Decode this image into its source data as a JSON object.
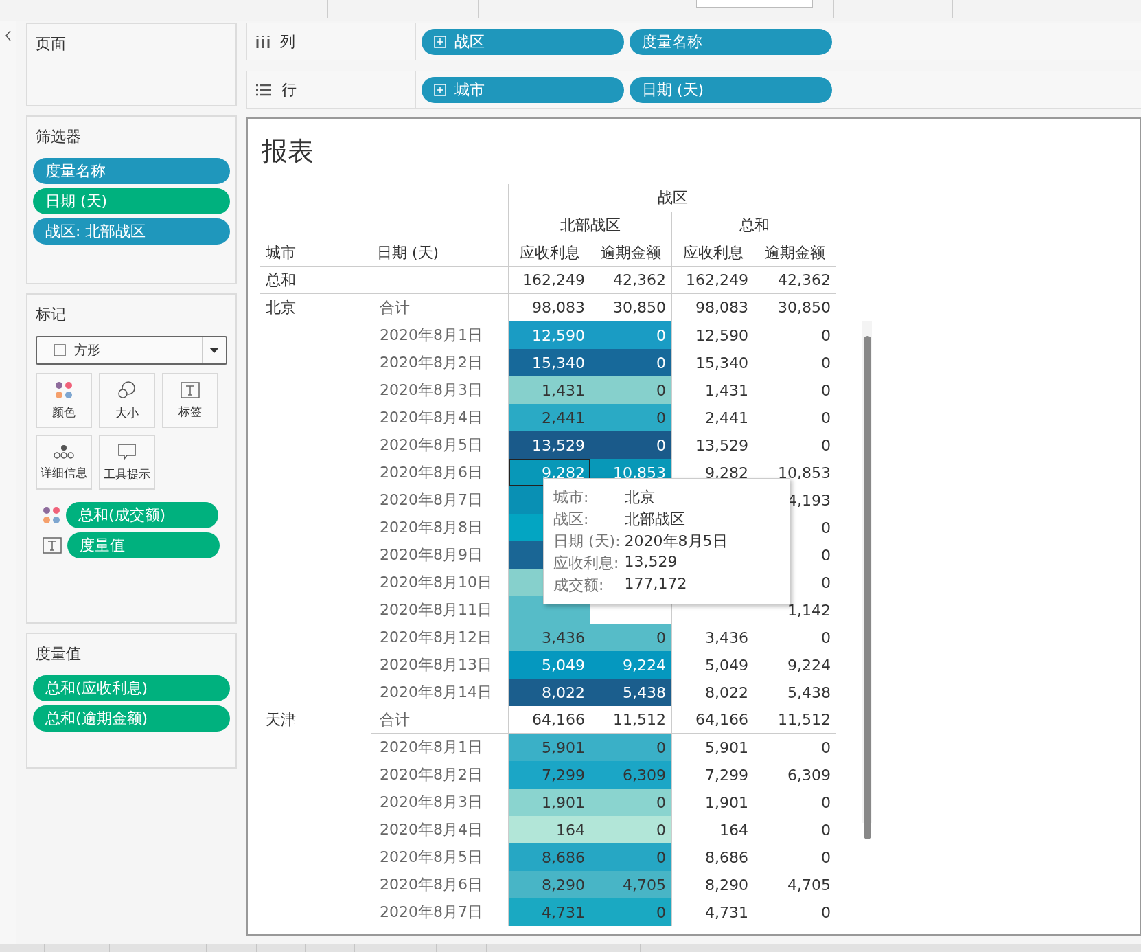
{
  "left_panel": {
    "pages": {
      "title": "页面"
    },
    "filters": {
      "title": "筛选器",
      "pills": [
        {
          "label": "度量名称",
          "kind": "dimension"
        },
        {
          "label": "日期 (天)",
          "kind": "measure"
        },
        {
          "label": "战区: 北部战区",
          "kind": "dimension"
        }
      ]
    },
    "marks": {
      "title": "标记",
      "mark_type": "方形",
      "buttons": [
        {
          "label": "颜色",
          "kind": "color"
        },
        {
          "label": "大小",
          "kind": "size"
        },
        {
          "label": "标签",
          "kind": "label"
        },
        {
          "label": "详细信息",
          "kind": "detail"
        },
        {
          "label": "工具提示",
          "kind": "tooltip"
        }
      ],
      "fields": [
        {
          "label": "总和(成交额)",
          "kind": "color"
        },
        {
          "label": "度量值",
          "kind": "label"
        }
      ]
    },
    "measure_values": {
      "title": "度量值",
      "pills": [
        {
          "label": "总和(应收利息)",
          "kind": "measure"
        },
        {
          "label": "总和(逾期金额)",
          "kind": "measure"
        }
      ]
    }
  },
  "shelves": [
    {
      "label": "列",
      "kind": "columns",
      "pills": [
        {
          "label": "战区",
          "kind": "dimension",
          "expandable": true
        },
        {
          "label": "度量名称",
          "kind": "dimension",
          "expandable": false
        }
      ]
    },
    {
      "label": "行",
      "kind": "rows",
      "pills": [
        {
          "label": "城市",
          "kind": "dimension",
          "expandable": true
        },
        {
          "label": "日期 (天)",
          "kind": "dimension",
          "expandable": false
        }
      ]
    }
  ],
  "view": {
    "title": "报表",
    "header": {
      "top": "战区",
      "groups": [
        "北部战区",
        "总和"
      ],
      "row_headers": [
        "城市",
        "日期 (天)"
      ],
      "columns": [
        "应收利息",
        "逾期金额",
        "应收利息",
        "逾期金额"
      ]
    },
    "rows": [
      {
        "kind": "grand_total",
        "label": "总和",
        "values": [
          "162,249",
          "42,362",
          "162,249",
          "42,362"
        ]
      },
      {
        "kind": "city_total",
        "city": "北京",
        "label": "合计",
        "values": [
          "98,083",
          "30,850",
          "98,083",
          "30,850"
        ]
      },
      {
        "kind": "day",
        "date": "2020年8月1日",
        "color": "#1a9cc4",
        "selected": false,
        "values": [
          "12,590",
          "0",
          "12,590",
          "0"
        ]
      },
      {
        "kind": "day",
        "date": "2020年8月2日",
        "color": "#17699a",
        "selected": false,
        "values": [
          "15,340",
          "0",
          "15,340",
          "0"
        ]
      },
      {
        "kind": "day",
        "date": "2020年8月3日",
        "color": "#86d0cc",
        "selected": false,
        "values": [
          "1,431",
          "0",
          "1,431",
          "0"
        ]
      },
      {
        "kind": "day",
        "date": "2020年8月4日",
        "color": "#2aaac5",
        "selected": false,
        "values": [
          "2,441",
          "0",
          "2,441",
          "0"
        ]
      },
      {
        "kind": "day",
        "date": "2020年8月5日",
        "color": "#1a5a8a",
        "selected": false,
        "values": [
          "13,529",
          "0",
          "13,529",
          "0"
        ]
      },
      {
        "kind": "day",
        "date": "2020年8月6日",
        "color": "#0898b8",
        "selected": true,
        "values": [
          "9,282",
          "10,853",
          "9,282",
          "10,853"
        ]
      },
      {
        "kind": "covered_day",
        "date": "2020年8月7日",
        "color": "#0990b4",
        "selected": false,
        "total_overdue": "4,193"
      },
      {
        "kind": "covered_day",
        "date": "2020年8月8日",
        "color": "#03a5c2",
        "selected": false,
        "total_overdue": "0"
      },
      {
        "kind": "covered_day",
        "date": "2020年8月9日",
        "color": "#1a6695",
        "selected": false,
        "total_overdue": "0"
      },
      {
        "kind": "covered_day",
        "date": "2020年8月10日",
        "color": "#86d0cc",
        "selected": false,
        "total_overdue": "0"
      },
      {
        "kind": "covered_day",
        "date": "2020年8月11日",
        "color": "#56bcc8",
        "selected": false,
        "total_overdue": "1,142"
      },
      {
        "kind": "day",
        "date": "2020年8月12日",
        "color": "#56bcc8",
        "selected": false,
        "values": [
          "3,436",
          "0",
          "3,436",
          "0"
        ]
      },
      {
        "kind": "day",
        "date": "2020年8月13日",
        "color": "#0598bf",
        "selected": false,
        "values": [
          "5,049",
          "9,224",
          "5,049",
          "9,224"
        ]
      },
      {
        "kind": "day",
        "date": "2020年8月14日",
        "color": "#1b5e8d",
        "selected": false,
        "values": [
          "8,022",
          "5,438",
          "8,022",
          "5,438"
        ]
      },
      {
        "kind": "city_total",
        "city": "天津",
        "label": "合计",
        "values": [
          "64,166",
          "11,512",
          "64,166",
          "11,512"
        ]
      },
      {
        "kind": "day",
        "date": "2020年8月1日",
        "color": "#3ab0c7",
        "selected": false,
        "values": [
          "5,901",
          "0",
          "5,901",
          "0"
        ]
      },
      {
        "kind": "day",
        "date": "2020年8月2日",
        "color": "#1ba6c6",
        "selected": false,
        "values": [
          "7,299",
          "6,309",
          "7,299",
          "6,309"
        ]
      },
      {
        "kind": "day",
        "date": "2020年8月3日",
        "color": "#8ad4cf",
        "selected": false,
        "values": [
          "1,901",
          "0",
          "1,901",
          "0"
        ]
      },
      {
        "kind": "day",
        "date": "2020年8月4日",
        "color": "#b2e6d8",
        "selected": false,
        "values": [
          "164",
          "0",
          "164",
          "0"
        ]
      },
      {
        "kind": "day",
        "date": "2020年8月5日",
        "color": "#26a7c4",
        "selected": false,
        "values": [
          "8,686",
          "0",
          "8,686",
          "0"
        ]
      },
      {
        "kind": "day",
        "date": "2020年8月6日",
        "color": "#48b5c6",
        "selected": false,
        "values": [
          "8,290",
          "4,705",
          "8,290",
          "4,705"
        ]
      },
      {
        "kind": "day",
        "date": "2020年8月7日",
        "color": "#1aa9c2",
        "selected": false,
        "values": [
          "4,731",
          "0",
          "4,731",
          "0"
        ]
      }
    ],
    "tooltip": {
      "rows": [
        {
          "key": "城市:",
          "value": "北京"
        },
        {
          "key": "战区:",
          "value": "北部战区"
        },
        {
          "key": "日期 (天):",
          "value": "2020年8月5日"
        },
        {
          "key": "应收利息:",
          "value": "13,529"
        },
        {
          "key": "成交额:",
          "value": "177,172"
        }
      ]
    }
  }
}
